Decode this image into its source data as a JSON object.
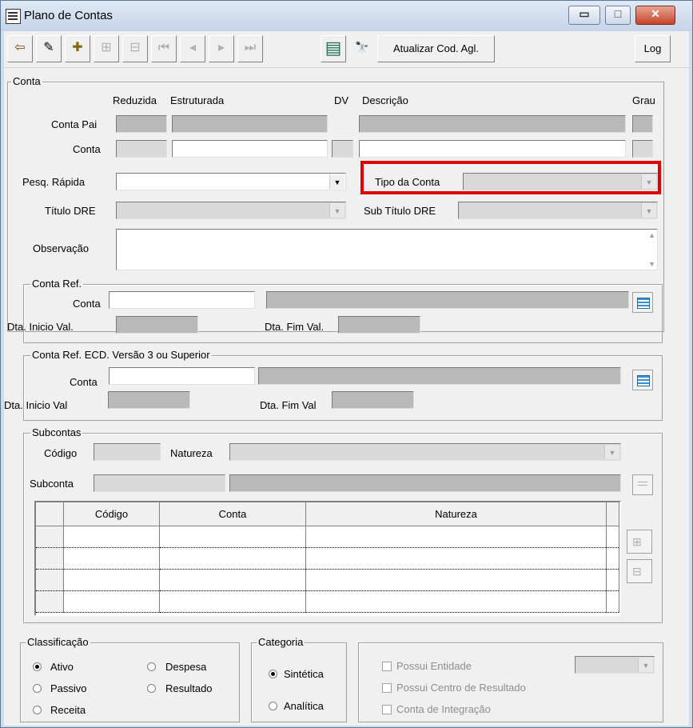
{
  "window": {
    "title": "Plano de Contas",
    "minimize": "▭",
    "maximize": "□",
    "close": "✕"
  },
  "toolbar": {
    "buttons": [
      {
        "name": "exit-icon",
        "glyph": "⇦",
        "enabled": true
      },
      {
        "name": "eraser-icon",
        "glyph": "✎",
        "enabled": true
      },
      {
        "name": "add-icon",
        "glyph": "✚",
        "enabled": true
      },
      {
        "name": "add-child-icon",
        "glyph": "⊞",
        "enabled": false
      },
      {
        "name": "remove-icon",
        "glyph": "⊟",
        "enabled": false
      },
      {
        "name": "first-icon",
        "glyph": "⏮",
        "enabled": false
      },
      {
        "name": "previous-icon",
        "glyph": "◂",
        "enabled": false
      },
      {
        "name": "next-icon",
        "glyph": "▸",
        "enabled": false
      },
      {
        "name": "last-icon",
        "glyph": "⏭",
        "enabled": false
      },
      {
        "name": "list-icon",
        "glyph": "▤",
        "enabled": true
      },
      {
        "name": "binoculars-icon",
        "glyph": "🔭",
        "enabled": true
      }
    ],
    "atualizar_label": "Atualizar Cod. Agl.",
    "log_label": "Log"
  },
  "conta": {
    "legend": "Conta",
    "col_reduzida": "Reduzida",
    "col_estruturada": "Estruturada",
    "col_dv": "DV",
    "col_descricao": "Descrição",
    "col_grau": "Grau",
    "conta_pai_label": "Conta Pai",
    "conta_label": "Conta",
    "pesq_rapida_label": "Pesq. Rápida",
    "tipo_conta_label": "Tipo da Conta",
    "titulo_dre_label": "Título DRE",
    "sub_titulo_dre_label": "Sub Título DRE",
    "observacao_label": "Observação"
  },
  "conta_ref": {
    "legend": "Conta Ref.",
    "conta_label": "Conta",
    "dta_inicio_label": "Dta. Inicio Val.",
    "dta_fim_label": "Dta. Fim Val."
  },
  "conta_ref_ecd": {
    "legend": "Conta Ref. ECD. Versão 3 ou Superior",
    "conta_label": "Conta",
    "dta_inicio_label": "Dta. Inicio Val",
    "dta_fim_label": "Dta. Fim Val"
  },
  "subcontas": {
    "legend": "Subcontas",
    "codigo_label": "Código",
    "natureza_label": "Natureza",
    "subconta_label": "Subconta",
    "columns": [
      "Código",
      "Conta",
      "Natureza"
    ]
  },
  "classificacao": {
    "legend": "Classificação",
    "options": [
      "Ativo",
      "Passivo",
      "Receita",
      "Despesa",
      "Resultado"
    ],
    "selected": "Ativo"
  },
  "categoria": {
    "legend": "Categoria",
    "options": [
      "Sintética",
      "Analítica"
    ],
    "selected": "Sintética"
  },
  "flags": {
    "possui_entidade": "Possui Entidade",
    "possui_centro": "Possui Centro de Resultado",
    "conta_integracao": "Conta de Integração"
  },
  "colors": {
    "highlight": "#e00000",
    "readonly_field": "#b9b9b9"
  }
}
